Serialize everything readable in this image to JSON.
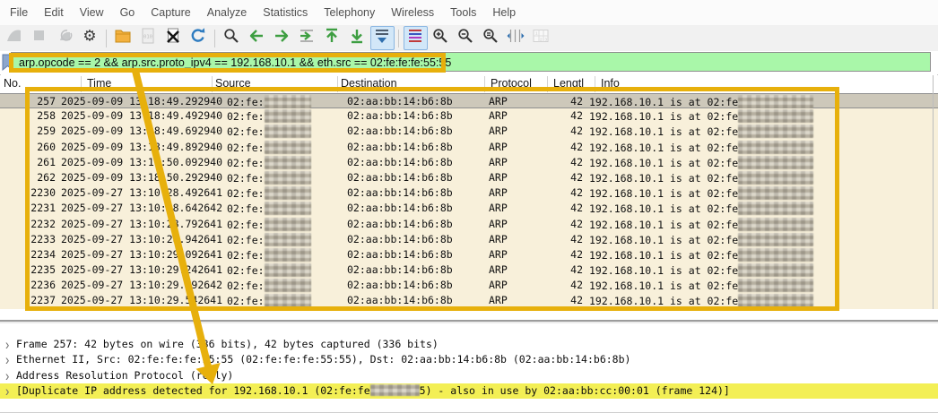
{
  "app": "Wireshark",
  "colors": {
    "filter_valid_green": "#a9f7a9",
    "arp_row_cream": "#f8f0da",
    "selected_row_gray": "#cdc8ba",
    "annotation_amber": "#e7b00c",
    "expert_warning_yellow": "#f3ef55",
    "nav_arrow_green": "#3d9e41",
    "reload_blue": "#2e7cc0"
  },
  "menu": {
    "items": [
      "File",
      "Edit",
      "View",
      "Go",
      "Capture",
      "Analyze",
      "Statistics",
      "Telephony",
      "Wireless",
      "Tools",
      "Help"
    ]
  },
  "toolbar": {
    "items": [
      {
        "icon": "start-capture-icon",
        "state": "disabled"
      },
      {
        "icon": "stop-capture-icon",
        "state": "disabled"
      },
      {
        "icon": "restart-capture-icon",
        "state": "disabled"
      },
      {
        "icon": "capture-options-icon",
        "state": "normal"
      },
      {
        "icon": "separator"
      },
      {
        "icon": "open-file-icon",
        "state": "normal"
      },
      {
        "icon": "save-file-icon",
        "state": "disabled"
      },
      {
        "icon": "close-file-icon",
        "state": "normal"
      },
      {
        "icon": "reload-file-icon",
        "state": "normal"
      },
      {
        "icon": "separator"
      },
      {
        "icon": "find-packet-icon",
        "state": "normal"
      },
      {
        "icon": "go-back-icon",
        "state": "normal"
      },
      {
        "icon": "go-forward-icon",
        "state": "normal"
      },
      {
        "icon": "go-to-packet-icon",
        "state": "normal"
      },
      {
        "icon": "go-to-top-icon",
        "state": "normal"
      },
      {
        "icon": "go-to-bottom-icon",
        "state": "normal"
      },
      {
        "icon": "auto-scroll-icon",
        "state": "active"
      },
      {
        "icon": "separator"
      },
      {
        "icon": "colorize-icon",
        "state": "active"
      },
      {
        "icon": "zoom-in-icon",
        "state": "normal"
      },
      {
        "icon": "zoom-out-icon",
        "state": "normal"
      },
      {
        "icon": "zoom-reset-icon",
        "state": "normal"
      },
      {
        "icon": "resize-columns-icon",
        "state": "normal"
      },
      {
        "icon": "layout-columns-icon",
        "state": "disabled"
      }
    ]
  },
  "filter": {
    "value": "arp.opcode == 2 && arp.src.proto_ipv4 == 192.168.10.1 && eth.src == 02:fe:fe:fe:55:55"
  },
  "packet_list": {
    "columns": [
      "No.",
      "Time",
      "Source",
      "Destination",
      "Protocol",
      "Lengtl",
      "Info"
    ],
    "shared": {
      "source_prefix": "02:fe:",
      "source_redacted": true,
      "destination": "02:aa:bb:14:b6:8b",
      "protocol": "ARP",
      "length": "42",
      "info_prefix": "192.168.10.1 is at 02:fe",
      "info_redacted": true
    },
    "rows": [
      {
        "no": "257",
        "time": "2025-09-09 13:18:49.292940",
        "selected": true
      },
      {
        "no": "258",
        "time": "2025-09-09 13:18:49.492940",
        "selected": false
      },
      {
        "no": "259",
        "time": "2025-09-09 13:18:49.692940",
        "selected": false
      },
      {
        "no": "260",
        "time": "2025-09-09 13:18:49.892940",
        "selected": false
      },
      {
        "no": "261",
        "time": "2025-09-09 13:18:50.092940",
        "selected": false
      },
      {
        "no": "262",
        "time": "2025-09-09 13:18:50.292940",
        "selected": false
      },
      {
        "no": "2230",
        "time": "2025-09-27 13:10:28.492641",
        "selected": false
      },
      {
        "no": "2231",
        "time": "2025-09-27 13:10:28.642642",
        "selected": false
      },
      {
        "no": "2232",
        "time": "2025-09-27 13:10:28.792641",
        "selected": false
      },
      {
        "no": "2233",
        "time": "2025-09-27 13:10:28.942641",
        "selected": false
      },
      {
        "no": "2234",
        "time": "2025-09-27 13:10:29.092641",
        "selected": false
      },
      {
        "no": "2235",
        "time": "2025-09-27 13:10:29.242641",
        "selected": false
      },
      {
        "no": "2236",
        "time": "2025-09-27 13:10:29.392642",
        "selected": false
      },
      {
        "no": "2237",
        "time": "2025-09-27 13:10:29.542641",
        "selected": false
      }
    ]
  },
  "detail_pane": {
    "rows": [
      {
        "before": "Frame 257: 42 bytes on wire (336 bits), 42 bytes captured (336 bits)",
        "redacted": false,
        "after": "",
        "highlighted": false
      },
      {
        "before": "Ethernet II, Src: 02:fe:fe:fe:55:55 (02:fe:fe:fe:55:55), Dst: 02:aa:bb:14:b6:8b (02:aa:bb:14:b6:8b)",
        "redacted": false,
        "after": "",
        "highlighted": false
      },
      {
        "before": "Address Resolution Protocol (reply)",
        "redacted": false,
        "after": "",
        "highlighted": false
      },
      {
        "before": "[Duplicate IP address detected for 192.168.10.1 (02:fe:fe",
        "redacted": true,
        "after": "5) - also in use by 02:aa:bb:cc:00:01 (frame 124)]",
        "highlighted": true
      }
    ]
  }
}
